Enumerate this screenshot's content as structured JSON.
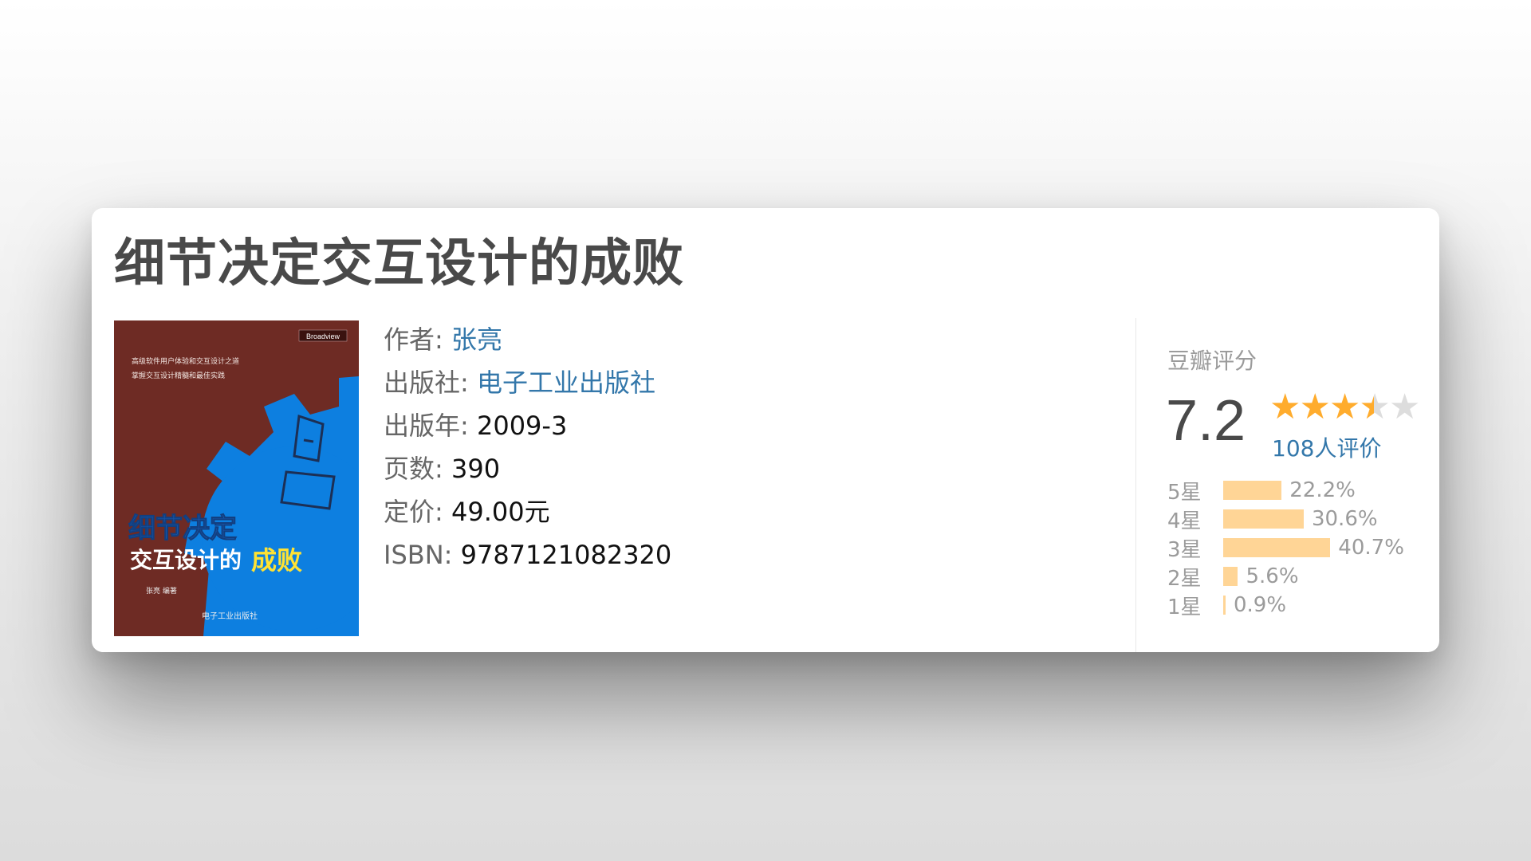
{
  "book": {
    "title": "细节决定交互设计的成败",
    "cover": {
      "publisher_badge": "Broadview",
      "blurb_line1": "高级软件用户体验和交互设计之道",
      "blurb_line2": "掌握交互设计精髓和最佳实践",
      "title_line1": "细节决定",
      "title_line2a": "交互设计的",
      "title_line2b": "成败",
      "author": "张亮 编著",
      "publisher": "电子工业出版社",
      "colors": {
        "background": "#6e2b24",
        "gear": "#0d7fe0",
        "title_text": "#ffffff",
        "highlight_text": "#ffe233"
      }
    },
    "info": {
      "author_label": "作者:",
      "author": "张亮",
      "publisher_label": "出版社:",
      "publisher": "电子工业出版社",
      "year_label": "出版年:",
      "year": "2009-3",
      "pages_label": "页数:",
      "pages": "390",
      "price_label": "定价:",
      "price": "49.00元",
      "isbn_label": "ISBN:",
      "isbn": "9787121082320"
    }
  },
  "rating": {
    "label": "豆瓣评分",
    "score": "7.2",
    "stars": [
      "full",
      "full",
      "full",
      "half",
      "empty"
    ],
    "votes": "108人评价",
    "distribution": [
      {
        "label": "5星",
        "pct_text": "22.2%",
        "pct": 22.2
      },
      {
        "label": "4星",
        "pct_text": "30.6%",
        "pct": 30.6
      },
      {
        "label": "3星",
        "pct_text": "40.7%",
        "pct": 40.7
      },
      {
        "label": "2星",
        "pct_text": "5.6%",
        "pct": 5.6
      },
      {
        "label": "1星",
        "pct_text": "0.9%",
        "pct": 0.9
      }
    ],
    "colors": {
      "star": "#ffac2d",
      "star_empty": "#dddddd",
      "bar": "#ffd596",
      "link": "#3377aa"
    }
  }
}
